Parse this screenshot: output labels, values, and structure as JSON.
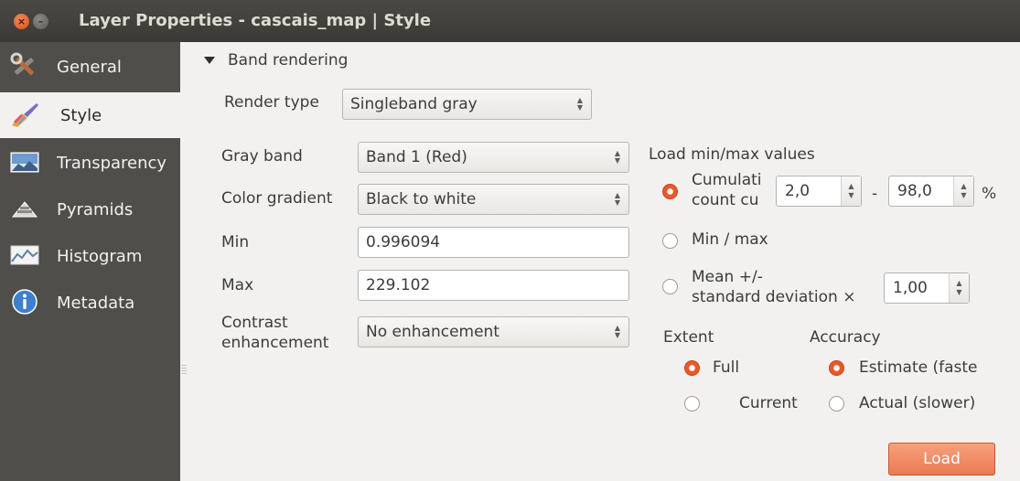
{
  "window": {
    "title": "Layer Properties - cascais_map | Style",
    "close_glyph": "×",
    "minimize_glyph": "–"
  },
  "sidebar": {
    "items": [
      {
        "label": "General",
        "icon": "tools-icon"
      },
      {
        "label": "Style",
        "icon": "paintbrush-icon",
        "active": true
      },
      {
        "label": "Transparency",
        "icon": "transparency-icon"
      },
      {
        "label": "Pyramids",
        "icon": "pyramid-icon"
      },
      {
        "label": "Histogram",
        "icon": "histogram-icon"
      },
      {
        "label": "Metadata",
        "icon": "info-icon"
      }
    ]
  },
  "band_rendering": {
    "section_label": "Band rendering",
    "render_type_label": "Render type",
    "render_type_value": "Singleband gray",
    "gray_band_label": "Gray band",
    "gray_band_value": "Band 1 (Red)",
    "color_gradient_label": "Color gradient",
    "color_gradient_value": "Black to white",
    "min_label": "Min",
    "min_value": "0.996094",
    "max_label": "Max",
    "max_value": "229.102",
    "contrast_label_line1": "Contrast",
    "contrast_label_line2": "enhancement",
    "contrast_value": "No enhancement"
  },
  "minmax": {
    "heading": "Load min/max values",
    "cumulative_line1": "Cumulati",
    "cumulative_line2": "count cu",
    "cumulative_low": "2,0",
    "dash": "-",
    "cumulative_high": "98,0",
    "percent": "%",
    "minmax_label": "Min / max",
    "mean_line1": "Mean +/-",
    "mean_line2": "standard deviation ×",
    "stddev_value": "1,00",
    "selected": "cumulative"
  },
  "extent": {
    "heading": "Extent",
    "full_label": "Full",
    "current_label": "Current",
    "selected": "full"
  },
  "accuracy": {
    "heading": "Accuracy",
    "estimate_label": "Estimate (faste",
    "actual_label": "Actual (slower)",
    "selected": "estimate"
  },
  "load_button": "Load",
  "colors": {
    "accent": "#e9592a",
    "sidebar_bg": "#4f4e4a",
    "titlebar_bg": "#3f3e3a",
    "window_bg": "#f2f1f0"
  }
}
